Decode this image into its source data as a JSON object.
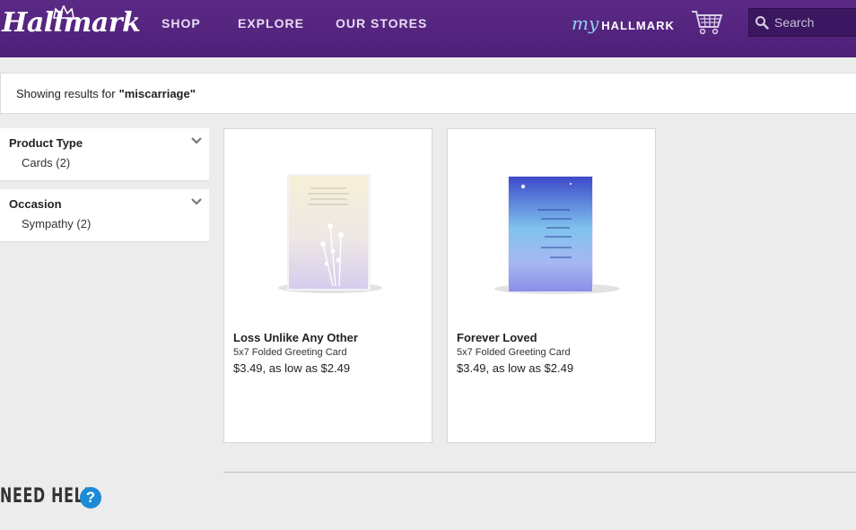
{
  "header": {
    "logo": "Hallmark",
    "nav": [
      "SHOP",
      "EXPLORE",
      "OUR STORES"
    ],
    "my_label": "my",
    "hallmark_label": "HALLMARK",
    "search_placeholder": "Search"
  },
  "results": {
    "prefix": "Showing results for",
    "query": "\"miscarriage\""
  },
  "filters": [
    {
      "title": "Product Type",
      "items": [
        "Cards (2)"
      ]
    },
    {
      "title": "Occasion",
      "items": [
        "Sympathy (2)"
      ]
    }
  ],
  "products": [
    {
      "name": "Loss Unlike Any Other",
      "type": "5x7 Folded Greeting Card",
      "price": "$3.49, as low as $2.49"
    },
    {
      "name": "Forever Loved",
      "type": "5x7 Folded Greeting Card",
      "price": "$3.49, as low as $2.49"
    }
  ],
  "help": {
    "label": "NEED HELP",
    "icon": "?"
  },
  "colors": {
    "header": "#5b2a86",
    "accent_blue": "#1b8bd6"
  }
}
